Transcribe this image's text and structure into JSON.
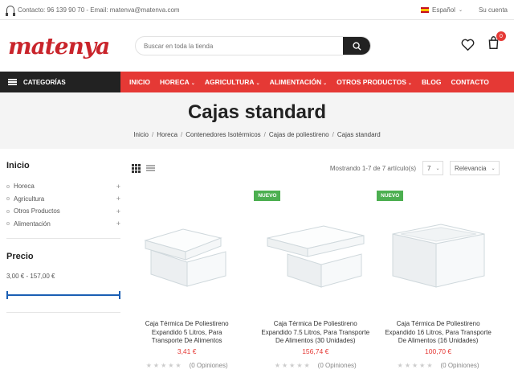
{
  "topbar": {
    "contact": "Contacto:  96 139 90 70  -  Email:  matenva@matenva.com",
    "language": "Español",
    "account": "Su cuenta"
  },
  "header": {
    "logo": "matenya",
    "search_placeholder": "Buscar en toda la tienda",
    "cart_count": "0"
  },
  "nav": {
    "categories": "CATEGORÍAS",
    "items": [
      {
        "label": "INICIO",
        "dropdown": false
      },
      {
        "label": "HORECA",
        "dropdown": true
      },
      {
        "label": "AGRICULTURA",
        "dropdown": true
      },
      {
        "label": "ALIMENTACIÓN",
        "dropdown": true
      },
      {
        "label": "OTROS PRODUCTOS",
        "dropdown": true
      },
      {
        "label": "BLOG",
        "dropdown": false
      },
      {
        "label": "CONTACTO",
        "dropdown": false
      }
    ]
  },
  "page": {
    "title": "Cajas standard",
    "breadcrumb": [
      "Inicio",
      "Horeca",
      "Contenedores Isotérmicos",
      "Cajas de poliestireno",
      "Cajas standard"
    ]
  },
  "sidebar": {
    "heading": "Inicio",
    "items": [
      "Horeca",
      "Agricultura",
      "Otros Productos",
      "Alimentación"
    ],
    "price_heading": "Precio",
    "price_range": "3,00 € - 157,00 €",
    "price_min": 3.0,
    "price_max": 157.0,
    "slider_min": 3.0,
    "slider_max": 157.0
  },
  "toolbar": {
    "showing": "Mostrando 1-7 de 7 artículo(s)",
    "per_page": "7",
    "sort": "Relevancia"
  },
  "products": [
    {
      "name": "Caja Térmica De Poliestireno Expandido 5 Litros, Para Transporte De Alimentos",
      "price": "3,41 €",
      "badge": "",
      "reviews": "(0 Opiniones)"
    },
    {
      "name": "Caja Térmica De Poliestireno Expandido 7.5 Litros, Para Transporte De Alimentos (30 Unidades)",
      "price": "156,74 €",
      "badge": "NUEVO",
      "reviews": "(0 Opiniones)"
    },
    {
      "name": "Caja Térmica De Poliestireno Expandido 16 Litros, Para Transporte De Alimentos (16 Unidades)",
      "price": "100,70 €",
      "badge": "NUEVO",
      "reviews": "(0 Opiniones)"
    }
  ],
  "colors": {
    "accent": "#e53935",
    "dark": "#222222",
    "badge": "#4caf50",
    "slider": "#1a5fb4"
  },
  "icons": [
    "headphones-icon",
    "flag-spain-icon",
    "search-icon",
    "heart-icon",
    "cart-icon",
    "hamburger-icon",
    "grid-view-icon",
    "list-view-icon",
    "plus-icon",
    "star-icon"
  ]
}
